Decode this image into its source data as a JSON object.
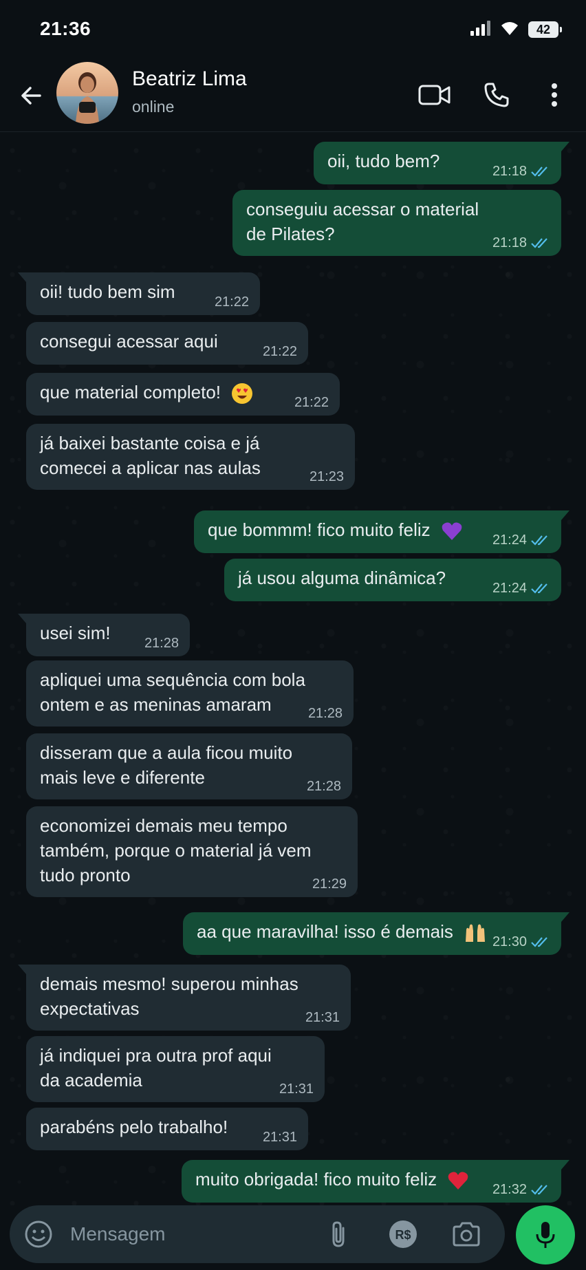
{
  "status_bar": {
    "time": "21:36",
    "battery": "42",
    "icons": [
      "signal-icon",
      "wifi-icon",
      "battery-icon"
    ]
  },
  "header": {
    "contact_name": "Beatriz Lima",
    "contact_status": "online",
    "icons": [
      "back-arrow-icon",
      "video-call-icon",
      "phone-icon",
      "more-vert-icon"
    ]
  },
  "messages": [
    {
      "dir": "out",
      "text": "oii, tudo bem?",
      "time": "21:18",
      "status": "read"
    },
    {
      "dir": "out",
      "text": "conseguiu acessar o material\nde Pilates?",
      "time": "21:18",
      "status": "read"
    },
    {
      "dir": "in",
      "text": "oii! tudo bem sim",
      "time": "21:22"
    },
    {
      "dir": "in",
      "text": "consegui acessar aqui",
      "time": "21:22"
    },
    {
      "dir": "in",
      "text": "que material completo!",
      "emoji": "heart-eyes-emoji",
      "time": "21:22"
    },
    {
      "dir": "in",
      "text": "já baixei bastante coisa e já\ncomecei a aplicar nas aulas",
      "time": "21:23"
    },
    {
      "dir": "out",
      "text": "que bommm! fico muito feliz",
      "emoji": "purple-heart-emoji",
      "time": "21:24",
      "status": "read"
    },
    {
      "dir": "out",
      "text": "já usou alguma dinâmica?",
      "time": "21:24",
      "status": "read"
    },
    {
      "dir": "in",
      "text": "usei sim!",
      "time": "21:28"
    },
    {
      "dir": "in",
      "text": "apliquei uma sequência com bola\nontem e as meninas amaram",
      "time": "21:28"
    },
    {
      "dir": "in",
      "text": "disseram que a aula ficou muito\nmais leve e diferente",
      "time": "21:28"
    },
    {
      "dir": "in",
      "text": "economizei demais meu tempo\ntambém, porque o material já vem\ntudo pronto",
      "time": "21:29"
    },
    {
      "dir": "out",
      "text": "aa que maravilha! isso é demais",
      "emoji": "raising-hands-emoji",
      "time": "21:30",
      "status": "read"
    },
    {
      "dir": "in",
      "text": "demais mesmo! superou minhas\nexpectativas",
      "time": "21:31"
    },
    {
      "dir": "in",
      "text": "já indiquei pra outra prof aqui\nda academia",
      "time": "21:31"
    },
    {
      "dir": "in",
      "text": "parabéns pelo trabalho!",
      "time": "21:31"
    },
    {
      "dir": "out",
      "text": "muito obrigada! fico muito feliz",
      "emoji": "red-heart-emoji",
      "time": "21:32",
      "status": "read"
    }
  ],
  "composer": {
    "placeholder": "Mensagem",
    "icons": [
      "emoji-icon",
      "attach-icon",
      "payment-icon",
      "camera-icon",
      "mic-icon"
    ]
  },
  "colors": {
    "background": "#0b1014",
    "incoming_bubble": "#202c33",
    "outgoing_bubble": "#144d37",
    "accent_green": "#21c063",
    "read_tick": "#53bdeb"
  }
}
